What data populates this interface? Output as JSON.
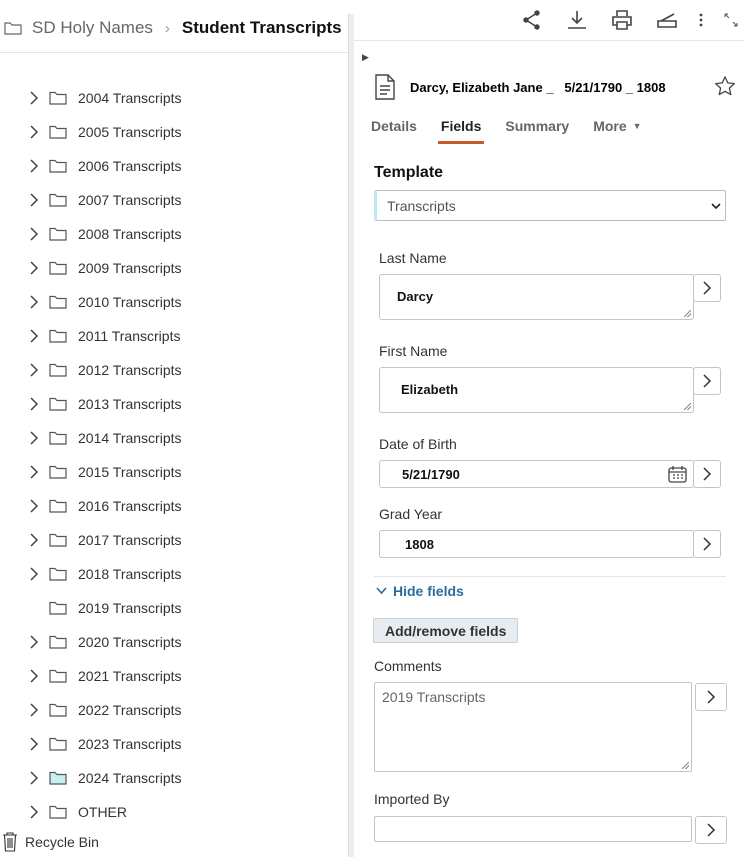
{
  "breadcrumb": {
    "root": "SD Holy Names",
    "separator": "›",
    "current": "Student Transcripts"
  },
  "tree": {
    "items": [
      {
        "label": "2004 Transcripts",
        "expandable": true
      },
      {
        "label": "2005 Transcripts",
        "expandable": true
      },
      {
        "label": "2006 Transcripts",
        "expandable": true
      },
      {
        "label": "2007 Transcripts",
        "expandable": true
      },
      {
        "label": "2008 Transcripts",
        "expandable": true
      },
      {
        "label": "2009 Transcripts",
        "expandable": true
      },
      {
        "label": "2010 Transcripts",
        "expandable": true
      },
      {
        "label": "2011 Transcripts",
        "expandable": true
      },
      {
        "label": "2012 Transcripts",
        "expandable": true
      },
      {
        "label": "2013 Transcripts",
        "expandable": true
      },
      {
        "label": "2014 Transcripts",
        "expandable": true
      },
      {
        "label": "2015 Transcripts",
        "expandable": true
      },
      {
        "label": "2016 Transcripts",
        "expandable": true
      },
      {
        "label": "2017 Transcripts",
        "expandable": true
      },
      {
        "label": "2018 Transcripts",
        "expandable": true
      },
      {
        "label": "2019 Transcripts",
        "expandable": false
      },
      {
        "label": "2020 Transcripts",
        "expandable": true
      },
      {
        "label": "2021 Transcripts",
        "expandable": true
      },
      {
        "label": "2022 Transcripts",
        "expandable": true
      },
      {
        "label": "2023 Transcripts",
        "expandable": true
      },
      {
        "label": "2024 Transcripts",
        "expandable": true,
        "highlight": true
      },
      {
        "label": "OTHER",
        "expandable": true
      }
    ],
    "recycle_bin": "Recycle Bin"
  },
  "toolbar": {
    "icons": [
      "share-icon",
      "download-icon",
      "print-icon",
      "scan-icon",
      "more-vertical-icon",
      "expand-icon"
    ]
  },
  "document": {
    "title": "Darcy, Elizabeth Jane _   5/21/1790 _ 1808"
  },
  "tabs": [
    {
      "label": "Details",
      "active": false
    },
    {
      "label": "Fields",
      "active": true
    },
    {
      "label": "Summary",
      "active": false
    },
    {
      "label": "More",
      "active": false,
      "dropdown": true
    }
  ],
  "template": {
    "label": "Template",
    "value": "Transcripts"
  },
  "fields": {
    "last_name": {
      "label": "Last Name",
      "value": "Darcy"
    },
    "first_name": {
      "label": "First Name",
      "value": "Elizabeth"
    },
    "dob": {
      "label": "Date of Birth",
      "value": "5/21/1790"
    },
    "grad_year": {
      "label": "Grad Year",
      "value": "1808"
    }
  },
  "hide_fields": "Hide fields",
  "add_remove_fields": "Add/remove fields",
  "comments": {
    "label": "Comments",
    "value": "2019 Transcripts"
  },
  "imported_by": {
    "label": "Imported By",
    "value": ""
  },
  "colors": {
    "tab_accent": "#c65a2a",
    "link": "#2a6d9e",
    "template_accent": "#bfe9ee",
    "highlight_folder": "#c8f0f4"
  }
}
